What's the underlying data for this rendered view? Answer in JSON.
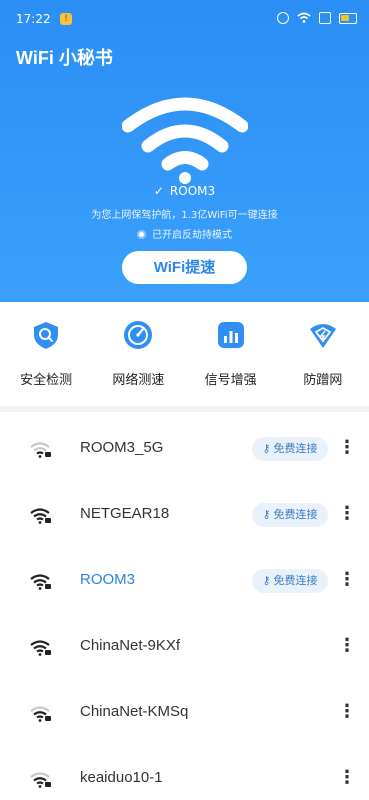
{
  "status_bar": {
    "time": "17:22",
    "app_badge": "!"
  },
  "header": {
    "title": "WiFi 小秘书",
    "ssid": "ROOM3",
    "subtitle": "为您上网保驾护航，1.3亿WiFi可一键连接",
    "guard_mode": "已开启反劫持模式",
    "speed_button": "WiFi提速",
    "accent_color": "#2b8ef4"
  },
  "tools": [
    {
      "icon": "shield-icon",
      "label": "安全检测"
    },
    {
      "icon": "speedometer-icon",
      "label": "网络测速"
    },
    {
      "icon": "signal-bars-icon",
      "label": "信号增强"
    },
    {
      "icon": "wifi-shield-icon",
      "label": "防蹭网"
    }
  ],
  "networks": [
    {
      "name": "ROOM3_5G",
      "free_label": "免费连接",
      "locked": true,
      "signal": 2
    },
    {
      "name": "NETGEAR18",
      "free_label": "免费连接",
      "locked": true,
      "signal": 4
    },
    {
      "name": "ROOM3",
      "free_label": "免费连接",
      "locked": true,
      "signal": 4,
      "active": true
    },
    {
      "name": "ChinaNet-9KXf",
      "free_label": "",
      "locked": true,
      "signal": 4
    },
    {
      "name": "ChinaNet-KMSq",
      "free_label": "",
      "locked": true,
      "signal": 3
    },
    {
      "name": "keaiduo10-1",
      "free_label": "",
      "locked": true,
      "signal": 3
    }
  ]
}
